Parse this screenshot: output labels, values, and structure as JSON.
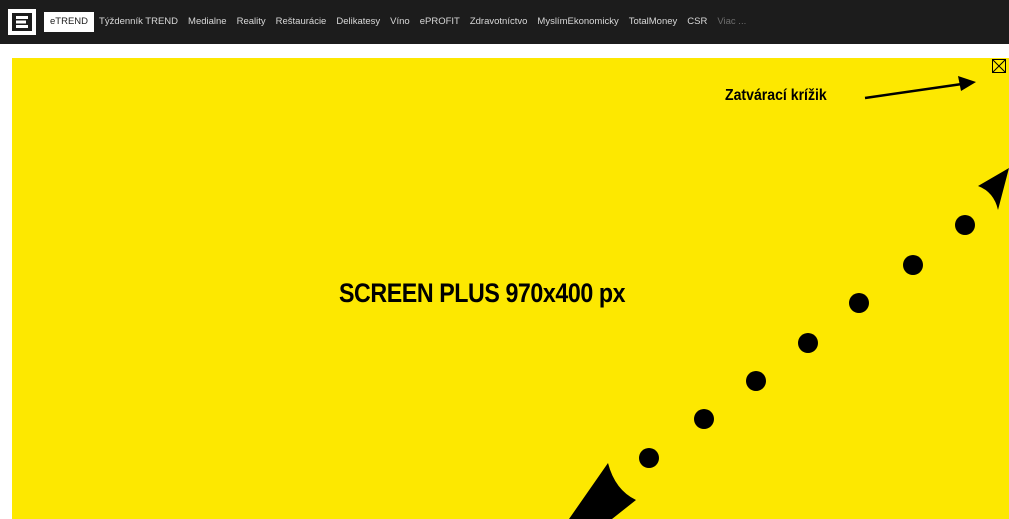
{
  "topbar": {
    "logo_icon": "e-logo-icon",
    "nav": [
      {
        "label": "eTREND",
        "active": true
      },
      {
        "label": "Týždenník TREND"
      },
      {
        "label": "Medialne"
      },
      {
        "label": "Reality"
      },
      {
        "label": "Reštaurácie"
      },
      {
        "label": "Delikatesy"
      },
      {
        "label": "Víno"
      },
      {
        "label": "ePROFIT"
      },
      {
        "label": "Zdravotníctvo"
      },
      {
        "label": "MyslímEkonomicky"
      },
      {
        "label": "TotalMoney"
      },
      {
        "label": "CSR"
      },
      {
        "label": "Viac ..."
      }
    ]
  },
  "banner": {
    "title": "SCREEN PLUS 970x400 px",
    "close_label": "Zatvárací krížik",
    "close_icon": "close-x-icon",
    "background_color": "#fde800"
  }
}
